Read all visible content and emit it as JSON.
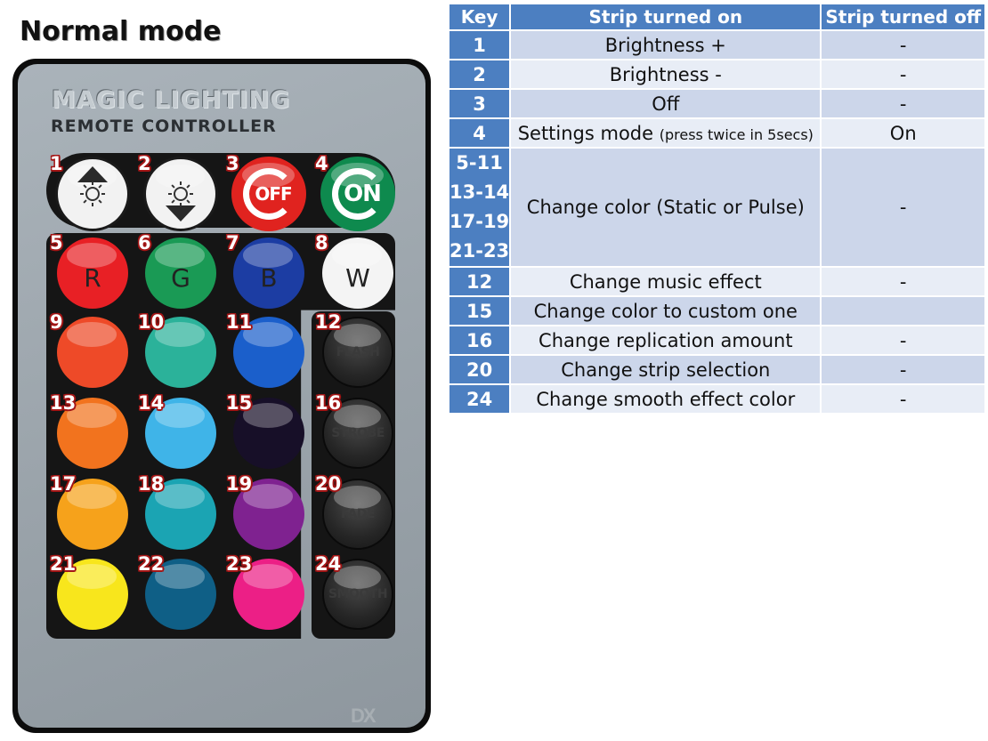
{
  "title": "Normal mode",
  "remote": {
    "brand": "MAGIC LIGHTING",
    "subtitle": "REMOTE CONTROLLER",
    "buttons": [
      {
        "key": "1",
        "kind": "bright-up",
        "color": "#f2f2f2"
      },
      {
        "key": "2",
        "kind": "bright-down",
        "color": "#f2f2f2"
      },
      {
        "key": "3",
        "kind": "off",
        "label": "OFF",
        "color": "#e0231f"
      },
      {
        "key": "4",
        "kind": "on",
        "label": "ON",
        "color": "#0e8a4e"
      },
      {
        "key": "5",
        "label": "R",
        "color": "#e82025"
      },
      {
        "key": "6",
        "label": "G",
        "color": "#1a9a55"
      },
      {
        "key": "7",
        "label": "B",
        "color": "#1c3da3"
      },
      {
        "key": "8",
        "label": "W",
        "color": "#f4f4f4"
      },
      {
        "key": "9",
        "label": "",
        "color": "#ee4a28"
      },
      {
        "key": "10",
        "label": "",
        "color": "#2bb29a"
      },
      {
        "key": "11",
        "label": "",
        "color": "#1b5fcb"
      },
      {
        "key": "12",
        "label": "FLASH",
        "color": "#242424"
      },
      {
        "key": "13",
        "label": "",
        "color": "#f2731e"
      },
      {
        "key": "14",
        "label": "",
        "color": "#3fb4e8"
      },
      {
        "key": "15",
        "label": "",
        "color": "#170f28"
      },
      {
        "key": "16",
        "label": "STROBE",
        "color": "#242424"
      },
      {
        "key": "17",
        "label": "",
        "color": "#f6a21b"
      },
      {
        "key": "18",
        "label": "",
        "color": "#1ba4b3"
      },
      {
        "key": "19",
        "label": "",
        "color": "#7f2290"
      },
      {
        "key": "20",
        "label": "FADE",
        "color": "#242424"
      },
      {
        "key": "21",
        "label": "",
        "color": "#f8e61c"
      },
      {
        "key": "22",
        "label": "",
        "color": "#0f5f86"
      },
      {
        "key": "23",
        "label": "",
        "color": "#ec1f86"
      },
      {
        "key": "24",
        "label": "SMOOTH",
        "color": "#242424"
      }
    ]
  },
  "table": {
    "headers": [
      "Key",
      "Strip turned on",
      "Strip turned off"
    ],
    "rows": [
      {
        "key": "1",
        "on": "Brightness +",
        "off": "-"
      },
      {
        "key": "2",
        "on": "Brightness -",
        "off": "-"
      },
      {
        "key": "3",
        "on": "Off",
        "off": "-"
      },
      {
        "key": "4",
        "on": "Settings mode",
        "on_note": "(press twice in 5secs)",
        "off": "On"
      },
      {
        "keys": [
          "5-11",
          "13-14",
          "17-19",
          "21-23"
        ],
        "on": "Change color (Static or Pulse)",
        "off": "-"
      },
      {
        "key": "12",
        "on": "Change music effect",
        "off": "-"
      },
      {
        "key": "15",
        "on": "Change color to custom one",
        "off": ""
      },
      {
        "key": "16",
        "on": "Change replication amount",
        "off": "-"
      },
      {
        "key": "20",
        "on": "Change strip selection",
        "off": "-"
      },
      {
        "key": "24",
        "on": "Change smooth effect color",
        "off": "-"
      }
    ]
  },
  "colors": {
    "header_blue": "#4c7fc1",
    "row_dark": "#ccd6ea",
    "row_light": "#e8edf6",
    "number_red": "#a31515"
  }
}
